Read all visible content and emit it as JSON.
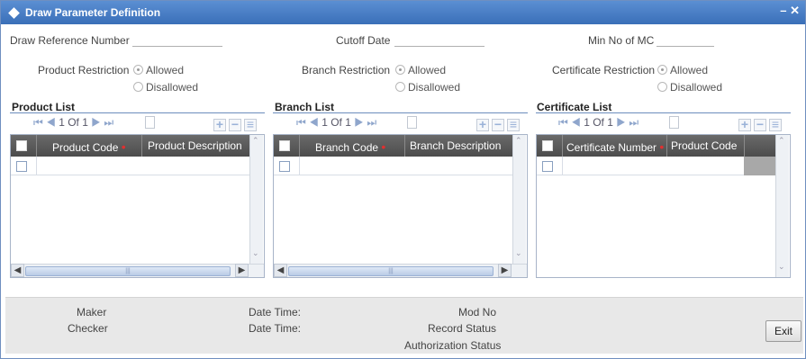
{
  "window": {
    "title": "Draw Parameter Definition",
    "controls": "– ✕"
  },
  "fields": {
    "draw_reference_number": {
      "label": "Draw Reference Number",
      "value": ""
    },
    "cutoff_date": {
      "label": "Cutoff Date",
      "value": ""
    },
    "min_no_of_mc": {
      "label": "Min No of MC",
      "value": ""
    }
  },
  "restrictions": {
    "product": {
      "label": "Product Restriction",
      "options": [
        "Allowed",
        "Disallowed"
      ],
      "selected": "Allowed"
    },
    "branch": {
      "label": "Branch Restriction",
      "options": [
        "Allowed",
        "Disallowed"
      ],
      "selected": "Allowed"
    },
    "certificate": {
      "label": "Certificate Restriction",
      "options": [
        "Allowed",
        "Disallowed"
      ],
      "selected": "Allowed"
    }
  },
  "lists": {
    "product": {
      "title": "Product List",
      "pager": "1 Of 1",
      "columns": [
        "Product Code",
        "Product Description"
      ]
    },
    "branch": {
      "title": "Branch List",
      "pager": "1 Of 1",
      "columns": [
        "Branch Code",
        "Branch Description"
      ]
    },
    "certificate": {
      "title": "Certificate List",
      "pager": "1 Of 1",
      "columns": [
        "Certificate Number",
        "Product Code"
      ]
    }
  },
  "footer": {
    "maker": "Maker",
    "checker": "Checker",
    "date_time_1": "Date Time:",
    "date_time_2": "Date Time:",
    "mod_no": "Mod No",
    "record_status": "Record Status",
    "authorization_status": "Authorization Status",
    "exit": "Exit"
  },
  "colors": {
    "titlebar": "#4a7fc4",
    "grid_header": "#5a5a5a",
    "required": "#e03030"
  }
}
